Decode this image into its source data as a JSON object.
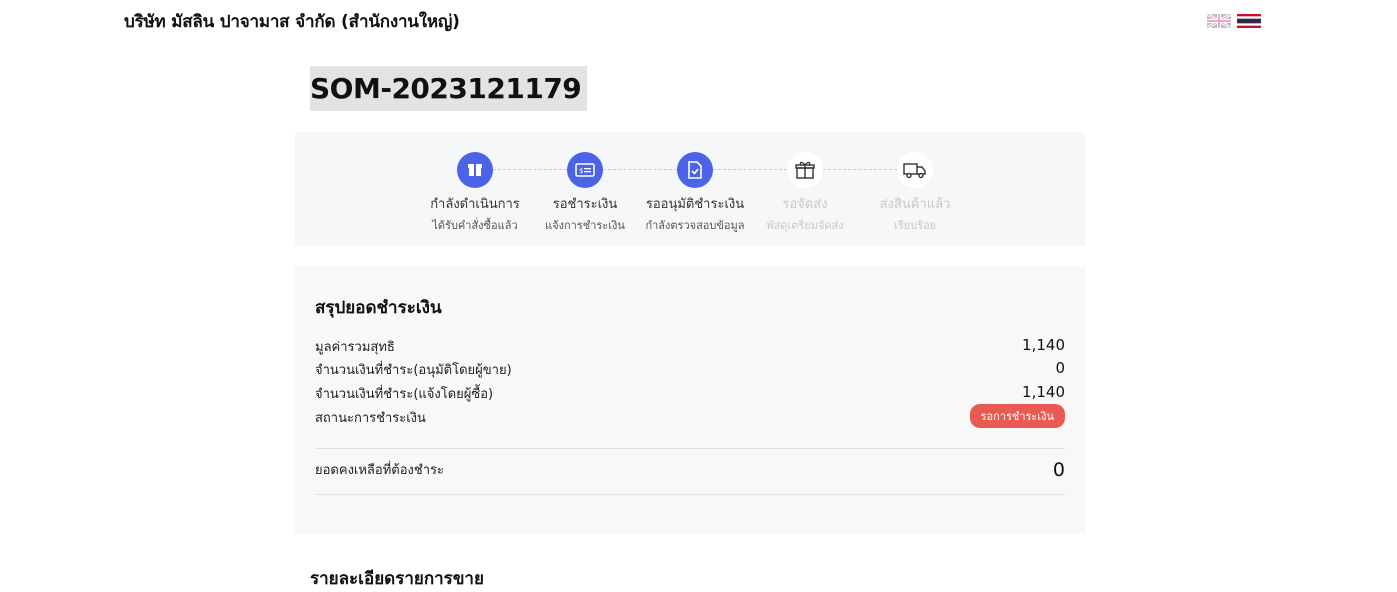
{
  "header": {
    "company_name": "บริษัท มัสลิน ปาจามาส จำกัด (สำนักงานใหญ่)",
    "languages": [
      {
        "name": "english-flag-icon",
        "active": false
      },
      {
        "name": "thai-flag-icon",
        "active": true
      }
    ]
  },
  "order": {
    "number": "SOM-2023121179"
  },
  "steps": [
    {
      "title": "กำลังดำเนินการ",
      "subtitle": "ได้รับคำสั่งซื้อแล้ว",
      "icon": "store-box-icon",
      "state": "done"
    },
    {
      "title": "รอชำระเงิน",
      "subtitle": "แจ้งการชำระเงิน",
      "icon": "payment-card-icon",
      "state": "done"
    },
    {
      "title": "รออนุมัติชำระเงิน",
      "subtitle": "กำลังตรวจสอบข้อมูล",
      "icon": "document-check-icon",
      "state": "done"
    },
    {
      "title": "รอจัดส่ง",
      "subtitle": "พัสดุเตรียมจัดส่ง",
      "icon": "gift-box-icon",
      "state": "todo"
    },
    {
      "title": "ส่งสินค้าแล้ว",
      "subtitle": "เรียบร้อย",
      "icon": "delivery-truck-icon",
      "state": "todo"
    }
  ],
  "summary": {
    "title": "สรุปยอดชำระเงิน",
    "net_total_label": "มูลค่ารวมสุทธิ",
    "net_total_value": "1,140",
    "paid_approved_label": "จำนวนเงินที่ชำระ(อนุมัติโดยผู้ขาย)",
    "paid_approved_value": "0",
    "paid_reported_label": "จำนวนเงินที่ชำระ(แจ้งโดยผู้ซื้อ)",
    "paid_reported_value": "1,140",
    "status_label": "สถานะการชำระเงิน",
    "status_value": "รอการชำระเงิน",
    "remaining_label": "ยอดคงเหลือที่ต้องชำระ",
    "remaining_value": "0"
  },
  "details": {
    "title": "รายละเอียดรายการขาย"
  },
  "colors": {
    "accent": "#4a63e7",
    "status_badge": "#e85a52"
  }
}
